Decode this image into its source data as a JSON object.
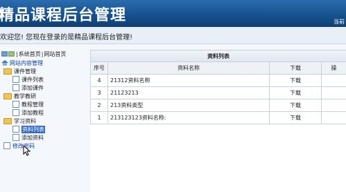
{
  "header": {
    "title": "精品课程后台管理",
    "right_text": "当前"
  },
  "welcome": "欢迎您! 您现在登录的是精品课程后台管理!",
  "topnav": {
    "system_home": "系统首页",
    "site_home": "网站首页",
    "sep": "|"
  },
  "tree": {
    "root": "网站内容管理",
    "groups": [
      {
        "label": "课件管理",
        "items": [
          "课件列表",
          "添加课件"
        ]
      },
      {
        "label": "教学教研",
        "items": [
          "教程管理",
          "添加教程"
        ]
      },
      {
        "label": "学习资料",
        "items": [
          "资料列表",
          "添加资料"
        ]
      }
    ],
    "change_password": "修改密码"
  },
  "table": {
    "caption": "资料列表",
    "headers": [
      "序号",
      "资料名称",
      "下载",
      "操"
    ],
    "rows": [
      {
        "no": "4",
        "name": "21312资料名称",
        "download": "下载"
      },
      {
        "no": "3",
        "name": "21123213",
        "download": "下载"
      },
      {
        "no": "2",
        "name": "213资料类型",
        "download": "下载"
      },
      {
        "no": "1",
        "name": "213123123资料名称:",
        "download": "下载"
      }
    ]
  },
  "colors": {
    "header_top": "#2a6cae",
    "header_bottom": "#0f3f74",
    "selected_bg": "#316ac5"
  }
}
